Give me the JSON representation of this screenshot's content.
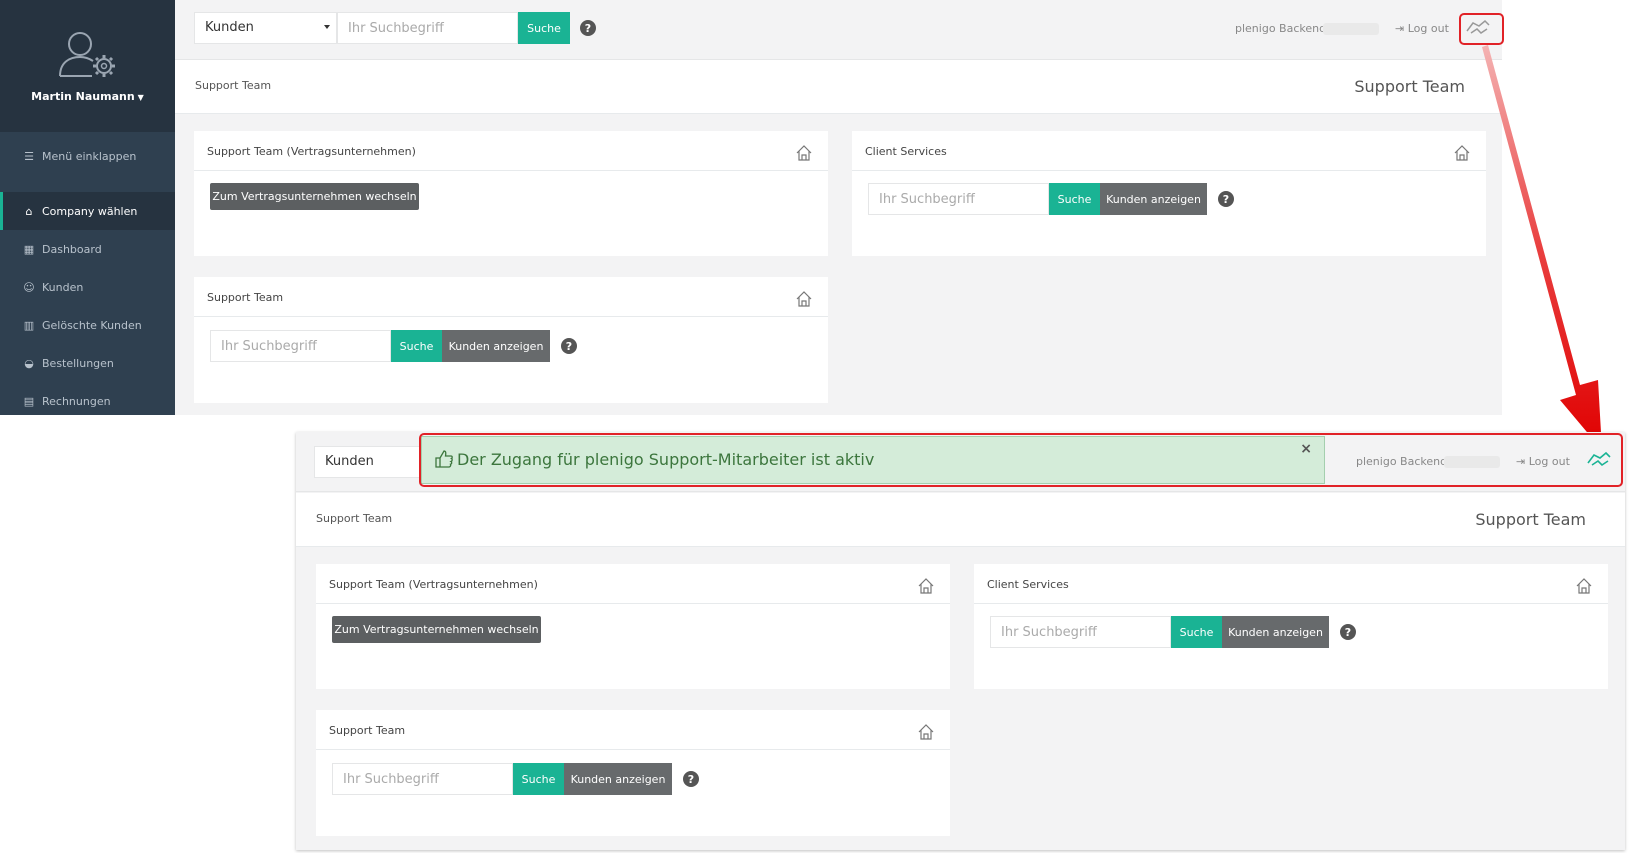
{
  "sidebar": {
    "user_name": "Martin Naumann",
    "items": [
      {
        "label": "Menü einklappen",
        "icon": "hamburger-icon"
      },
      {
        "label": "Company wählen",
        "icon": "home-icon"
      },
      {
        "label": "Dashboard",
        "icon": "grid-icon"
      },
      {
        "label": "Kunden",
        "icon": "user-icon"
      },
      {
        "label": "Gelöschte Kunden",
        "icon": "trash-icon"
      },
      {
        "label": "Bestellungen",
        "icon": "basket-icon"
      },
      {
        "label": "Rechnungen",
        "icon": "document-icon"
      }
    ]
  },
  "topbar": {
    "select_value": "Kunden",
    "search_placeholder": "Ihr Suchbegriff",
    "search_button": "Suche",
    "backend_label": "plenigo Backend",
    "logout_label": "Log out"
  },
  "page": {
    "breadcrumb": "Support Team",
    "title": "Support Team"
  },
  "boxes": {
    "contract": {
      "title": "Support Team (Vertragsunternehmen)",
      "button": "Zum Vertragsunternehmen wechseln"
    },
    "client_services": {
      "title": "Client Services",
      "placeholder": "Ihr Suchbegriff",
      "search": "Suche",
      "show": "Kunden anzeigen"
    },
    "support_team": {
      "title": "Support Team",
      "placeholder": "Ihr Suchbegriff",
      "search": "Suche",
      "show": "Kunden anzeigen"
    }
  },
  "alert": {
    "text": "Der Zugang für plenigo Support-Mitarbeiter ist aktiv",
    "close": "×"
  },
  "colors": {
    "accent": "#1ab394",
    "sidebar": "#2f4050",
    "annotation": "#e12227",
    "alert_bg": "#d4ecd9"
  }
}
